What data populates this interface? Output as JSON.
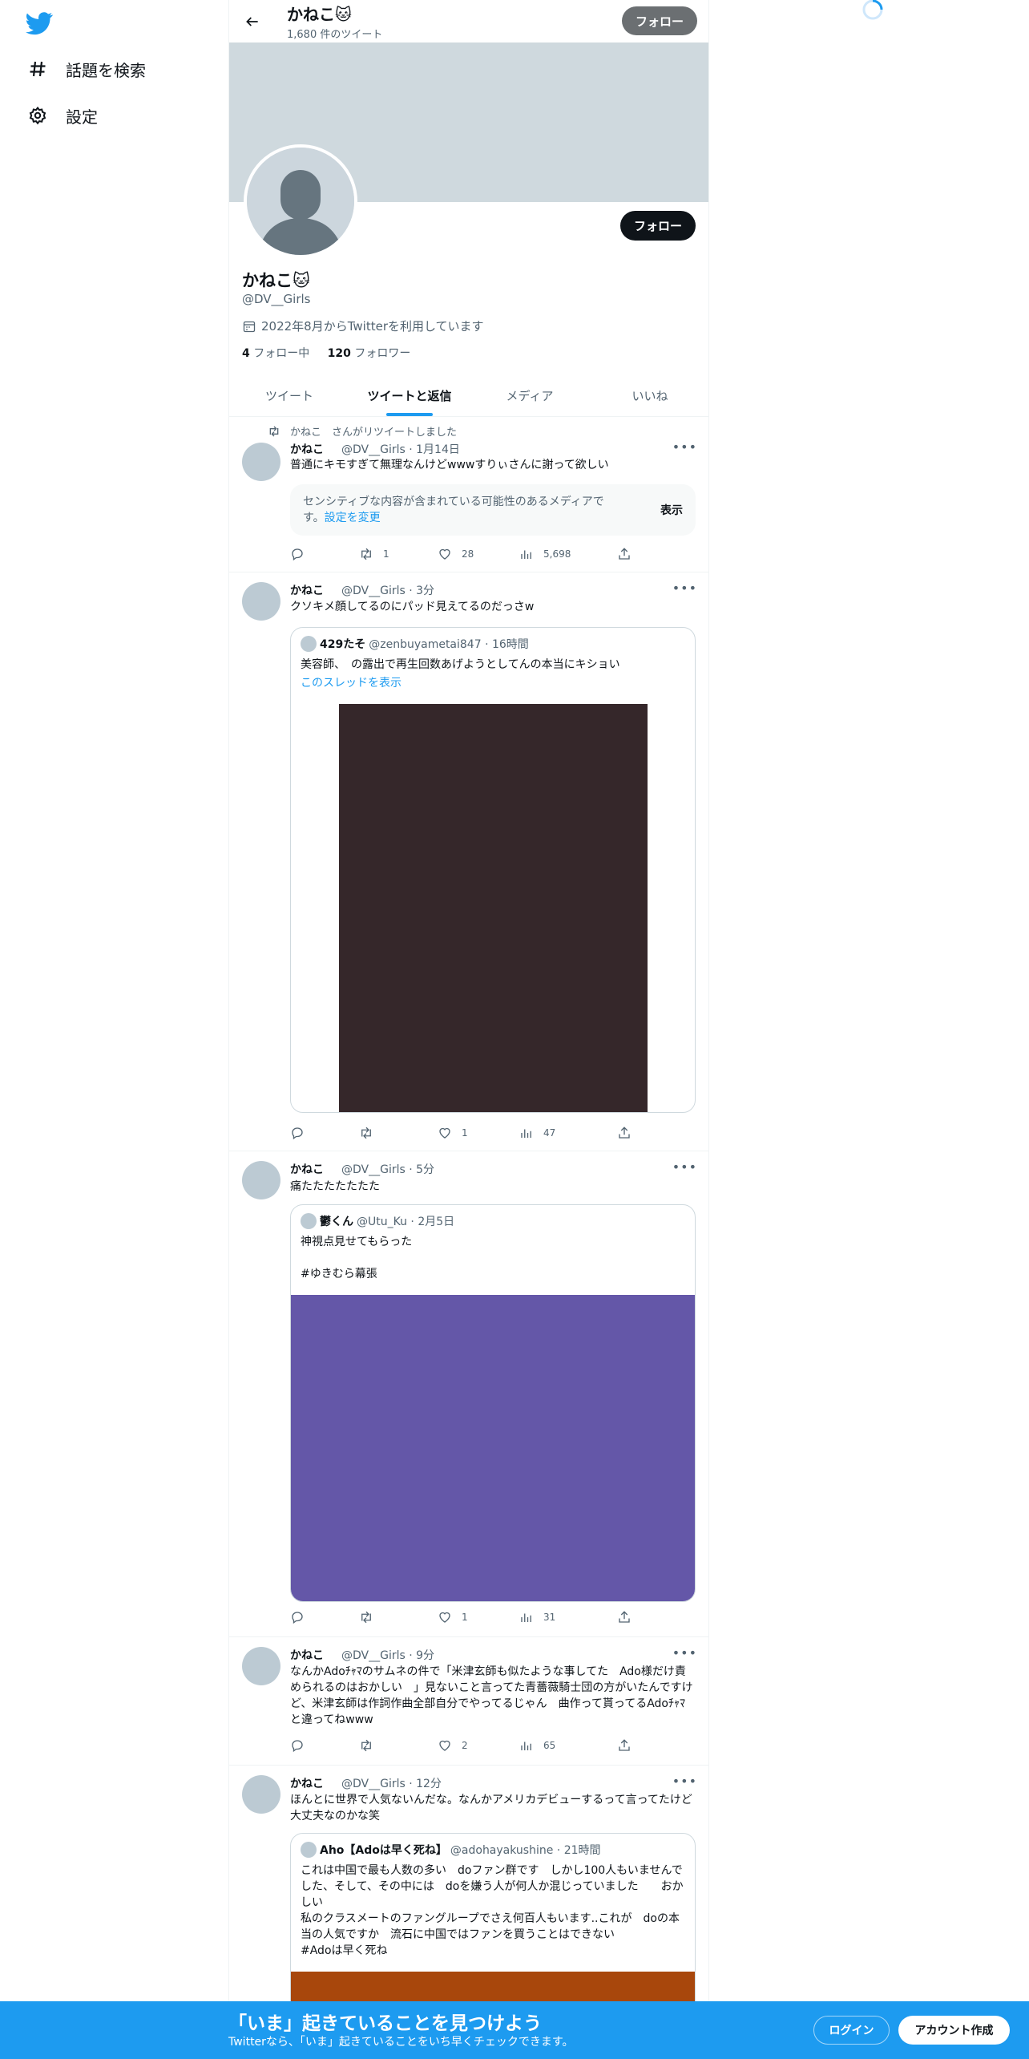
{
  "nav": {
    "items": [
      {
        "label": "話題を検索",
        "icon": "hashtag-icon"
      },
      {
        "label": "設定",
        "icon": "gear-icon"
      }
    ]
  },
  "header": {
    "name": "かねこ🐱",
    "tweet_count": "1,680 件のツイート",
    "follow_label": "フォロー"
  },
  "profile": {
    "name": "かねこ🐱",
    "handle": "@DV__Girls",
    "joined": "2022年8月からTwitterを利用しています",
    "following_count": "4",
    "following_label": "フォロー中",
    "followers_count": "120",
    "followers_label": "フォロワー",
    "follow_label": "フォロー"
  },
  "tabs": [
    {
      "label": "ツイート",
      "active": false
    },
    {
      "label": "ツイートと返信",
      "active": true
    },
    {
      "label": "メディア",
      "active": false
    },
    {
      "label": "いいね",
      "active": false
    }
  ],
  "tweets": [
    {
      "retweet_note": "かねこ　さんがリツイートしました",
      "name": "かねこ",
      "handle_time": "@DV__Girls · 1月14日",
      "text": "普通にキモすぎて無理なんけどwwwすりぃさんに謝って欲しい",
      "sensitive_text": "センシティブな内容が含まれている可能性のあるメディアです。",
      "sensitive_link": "設定を変更",
      "sensitive_show": "表示",
      "replies": "",
      "retweets": "1",
      "likes": "28",
      "views": "5,698"
    },
    {
      "name": "かねこ",
      "handle_time": "@DV__Girls · 3分",
      "text": "クソキメ顔してるのにパッド見えてるのだっさw",
      "quote": {
        "name": "429たそ",
        "handle_time": "@zenbuyametai847 · 16時間",
        "text": "美容師、　の露出で再生回数あげようとしてんの本当にキショい",
        "thread_link": "このスレッドを表示",
        "media_color": "#35272a"
      },
      "replies": "",
      "retweets": "",
      "likes": "1",
      "views": "47"
    },
    {
      "name": "かねこ",
      "handle_time": "@DV__Girls · 5分",
      "text": "痛たたたたたたた",
      "quote": {
        "name": "鬱くん",
        "handle_time": "@Utu_Ku · 2月5日",
        "text": "神視点見せてもらった\n\n#ゆきむら幕張",
        "media_color": "#6457a8"
      },
      "replies": "",
      "retweets": "",
      "likes": "1",
      "views": "31"
    },
    {
      "name": "かねこ",
      "handle_time": "@DV__Girls · 9分",
      "text": "なんかAdoﾁｬﾏのサムネの件で「米津玄師も似たような事してた　Ado様だけ責められるのはおかしい　」見ないこと言ってた青薔薇騎士団の方がいたんですけど、米津玄師は作詞作曲全部自分でやってるじゃん　曲作って貰ってるAdoﾁｬﾏと違ってねwww",
      "replies": "",
      "retweets": "",
      "likes": "2",
      "views": "65"
    },
    {
      "name": "かねこ",
      "handle_time": "@DV__Girls · 12分",
      "text": "ほんとに世界で人気ないんだな。なんかアメリカデビューするって言ってたけど大丈夫なのかな笑",
      "quote": {
        "name": "Aho【Adoは早く死ね】",
        "handle_time": "@adohayakushine · 21時間",
        "text": "これは中国で最も人数の多い　doファン群です　しかし100人もいませんでした、そして、その中には　doを嫌う人が何人か混じっていました　　おかしい\n私のクラスメートのファングループでさえ何百人もいます..これが　doの本当の人気ですか　流石に中国ではファンを買うことはできない\n#Adoは早く死ね",
        "media_color": "#a8470c"
      }
    }
  ],
  "bottom_bar": {
    "title": "「いま」起きていることを見つけよう",
    "subtitle": "Twitterなら、「いま」起きていることをいち早くチェックできます。",
    "login_label": "ログイン",
    "signup_label": "アカウント作成"
  },
  "colors": {
    "accent": "#1d9bf0",
    "banner": "#cfd9de",
    "text": "#0f1419",
    "muted": "#536471"
  }
}
